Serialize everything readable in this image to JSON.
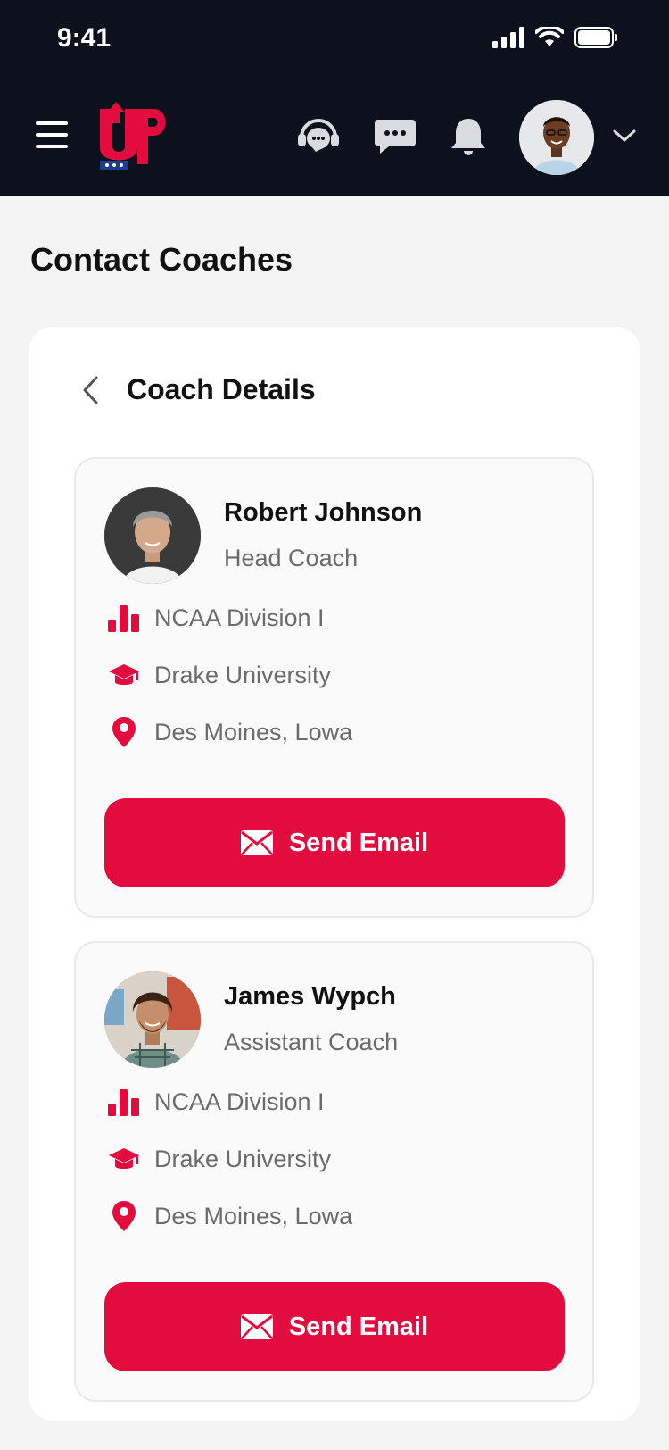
{
  "status": {
    "time": "9:41"
  },
  "header": {
    "logo_text": "UP",
    "icons": [
      "menu-icon",
      "support-headset-icon",
      "chat-icon",
      "bell-icon",
      "avatar",
      "chevron-down-icon"
    ]
  },
  "page": {
    "title": "Contact Coaches"
  },
  "panel": {
    "title": "Coach Details"
  },
  "coaches": [
    {
      "name": "Robert Johnson",
      "role": "Head Coach",
      "division": "NCAA Division I",
      "school": "Drake University",
      "location": "Des Moines, Lowa",
      "button": "Send Email"
    },
    {
      "name": "James Wypch",
      "role": "Assistant Coach",
      "division": "NCAA Division I",
      "school": "Drake University",
      "location": "Des Moines, Lowa",
      "button": "Send Email"
    }
  ],
  "colors": {
    "accent": "#e20d3e",
    "topbar": "#0d111d",
    "background": "#f4f4f4"
  }
}
